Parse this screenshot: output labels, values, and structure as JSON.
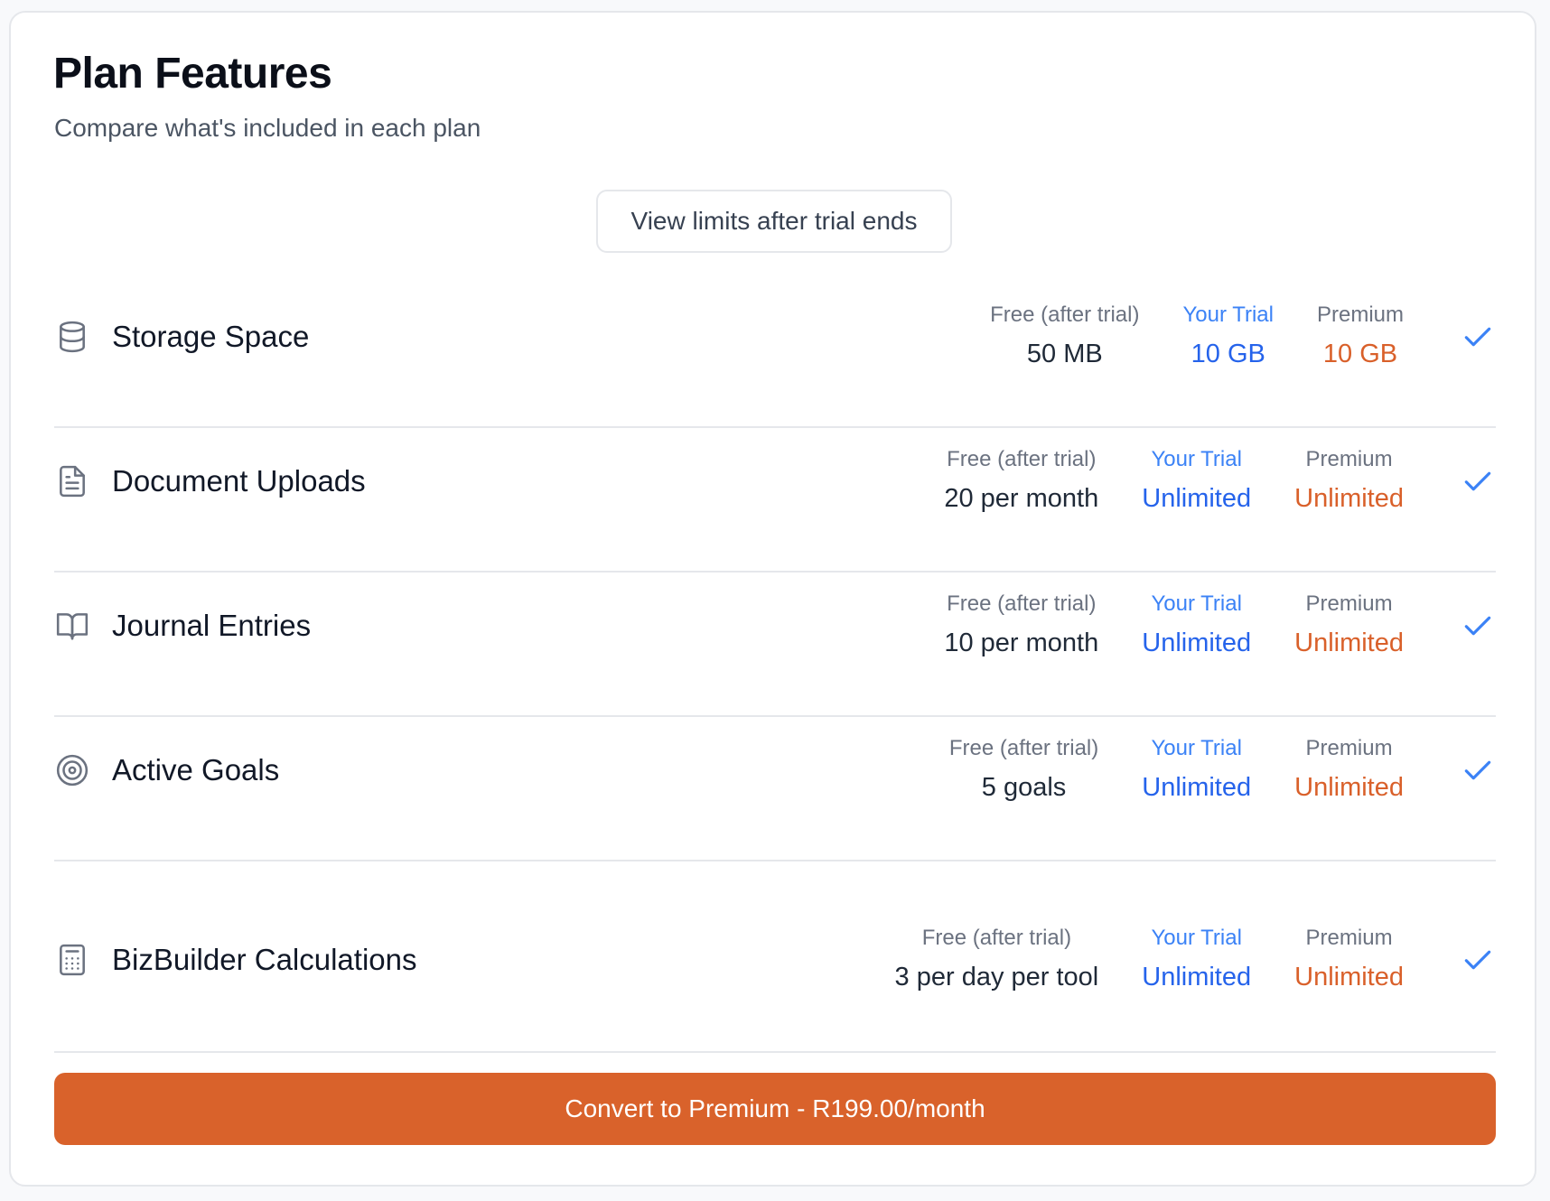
{
  "header": {
    "title": "Plan Features",
    "subtitle": "Compare what's included in each plan"
  },
  "toggle": {
    "label": "View limits after trial ends"
  },
  "columns": {
    "free": "Free (after trial)",
    "trial": "Your Trial",
    "premium": "Premium"
  },
  "features": [
    {
      "icon": "database-icon",
      "label": "Storage Space",
      "free": "50 MB",
      "trial": "10 GB",
      "premium": "10 GB",
      "included": true
    },
    {
      "icon": "document-icon",
      "label": "Document Uploads",
      "free": "20 per month",
      "trial": "Unlimited",
      "premium": "Unlimited",
      "included": true
    },
    {
      "icon": "book-icon",
      "label": "Journal Entries",
      "free": "10 per month",
      "trial": "Unlimited",
      "premium": "Unlimited",
      "included": true
    },
    {
      "icon": "target-icon",
      "label": "Active Goals",
      "free": "5 goals",
      "trial": "Unlimited",
      "premium": "Unlimited",
      "included": true
    },
    {
      "icon": "calculator-icon",
      "label": "BizBuilder Calculations",
      "free": "3 per day per tool",
      "trial": "Unlimited",
      "premium": "Unlimited",
      "included": true
    }
  ],
  "cta": {
    "label": "Convert to Premium - R199.00/month"
  },
  "colors": {
    "accent": "#d9622b",
    "trial_blue": "#2563eb",
    "check_blue": "#3b82f6",
    "premium_orange": "#d9602a"
  }
}
